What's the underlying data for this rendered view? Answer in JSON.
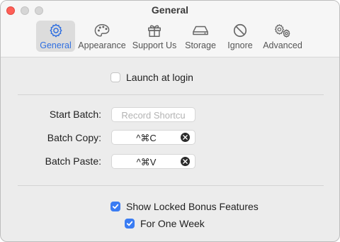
{
  "window": {
    "title": "General"
  },
  "toolbar": {
    "tabs": [
      {
        "label": "General",
        "icon": "gear-icon",
        "active": true
      },
      {
        "label": "Appearance",
        "icon": "palette-icon",
        "active": false
      },
      {
        "label": "Support Us",
        "icon": "gift-icon",
        "active": false
      },
      {
        "label": "Storage",
        "icon": "drive-icon",
        "active": false
      },
      {
        "label": "Ignore",
        "icon": "prohibited-icon",
        "active": false
      },
      {
        "label": "Advanced",
        "icon": "gears-icon",
        "active": false
      }
    ],
    "accent_color": "#2f6fe0"
  },
  "general": {
    "launch_at_login": {
      "label": "Launch at login",
      "checked": false
    },
    "shortcuts": {
      "start_batch": {
        "label": "Start Batch:",
        "value": "",
        "placeholder": "Record Shortcu"
      },
      "batch_copy": {
        "label": "Batch Copy:",
        "value": "^⌘C"
      },
      "batch_paste": {
        "label": "Batch Paste:",
        "value": "^⌘V"
      }
    },
    "show_locked_bonus": {
      "label": "Show Locked Bonus Features",
      "checked": true
    },
    "for_one_week": {
      "label": "For One Week",
      "checked": true
    },
    "checkbox_color": "#3a7cf3"
  }
}
